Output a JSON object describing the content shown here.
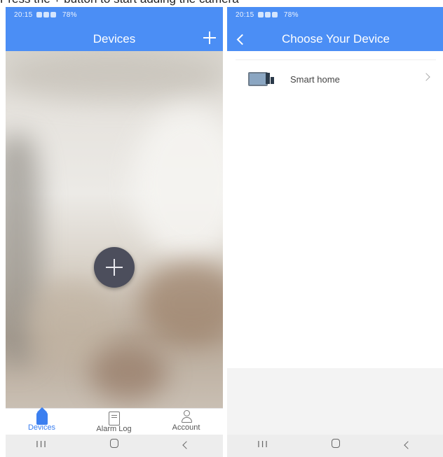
{
  "caption": "Press the + button to start adding the camera",
  "status_bar": {
    "time": "20:15",
    "battery": "78%"
  },
  "left_screen": {
    "title": "Devices",
    "tabs": [
      {
        "label": "Devices",
        "icon": "home-icon",
        "active": true
      },
      {
        "label": "Alarm Log",
        "icon": "message-icon",
        "active": false
      },
      {
        "label": "Account",
        "icon": "user-icon",
        "active": false
      }
    ]
  },
  "right_screen": {
    "title": "Choose Your Device",
    "device_list": [
      {
        "label": "Smart home",
        "icon": "smart-home-device-icon"
      }
    ]
  },
  "system_nav": {
    "recent": "III",
    "home": "home",
    "back": "back"
  },
  "colors": {
    "accent": "#4b8ef5",
    "active_tab": "#3b7ff0",
    "fab": "#4c4e5c"
  }
}
